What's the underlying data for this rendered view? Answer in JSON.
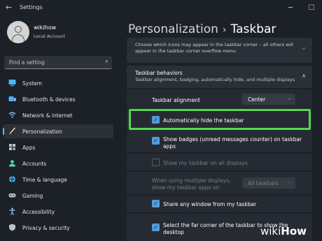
{
  "window": {
    "title": "Settings",
    "back_glyph": "←",
    "minimize_glyph": "─",
    "maximize_glyph": "☐"
  },
  "user": {
    "name": "wikihow",
    "account_type": "Local Account"
  },
  "search": {
    "placeholder": "Find a setting"
  },
  "sidebar": {
    "items": [
      {
        "label": "System",
        "icon": "monitor-icon",
        "color": "#4cb4ff"
      },
      {
        "label": "Bluetooth & devices",
        "icon": "bluetooth-icon",
        "color": "#4cb4ff"
      },
      {
        "label": "Network & internet",
        "icon": "wifi-icon",
        "color": "#8fc9ff"
      },
      {
        "label": "Personalization",
        "icon": "brush-icon",
        "color": "#f0a070",
        "active": true
      },
      {
        "label": "Apps",
        "icon": "apps-icon",
        "color": "#b8c4d4"
      },
      {
        "label": "Accounts",
        "icon": "accounts-icon",
        "color": "#5cd0a0"
      },
      {
        "label": "Time & language",
        "icon": "globe-icon",
        "color": "#4cb4ff"
      },
      {
        "label": "Gaming",
        "icon": "gamepad-icon",
        "color": "#b8c4d4"
      },
      {
        "label": "Accessibility",
        "icon": "accessibility-icon",
        "color": "#8fc9ff"
      },
      {
        "label": "Privacy & security",
        "icon": "shield-icon",
        "color": "#b8c4d4"
      }
    ]
  },
  "header": {
    "breadcrumb_parent": "Personalization",
    "breadcrumb_separator": "›",
    "page_title": "Taskbar"
  },
  "corner_overflow": {
    "description": "Choose which icons may appear in the taskbar corner – all others will appear in the taskbar corner overflow menu"
  },
  "behaviors": {
    "title": "Taskbar behaviors",
    "subtitle": "Taskbar alignment, badging, automatically hide, and multiple displays",
    "alignment_label": "Taskbar alignment",
    "alignment_value": "Center",
    "auto_hide_label": "Automatically hide the taskbar",
    "auto_hide_checked": true,
    "badges_label": "Show badges (unread messages counter) on taskbar apps",
    "badges_checked": true,
    "all_displays_label": "Show my taskbar on all displays",
    "all_displays_checked": false,
    "multi_display_label": "When using multiple displays, show my taskbar apps on",
    "multi_display_value": "All taskbars",
    "share_window_label": "Share any window from my taskbar",
    "share_window_checked": true,
    "far_corner_label": "Select the far corner of the taskbar to show the desktop",
    "far_corner_checked": true
  },
  "watermark": {
    "part1": "wiki",
    "part2": "How"
  },
  "colors": {
    "accent": "#4f9ddd",
    "highlight": "#52d94a",
    "background": "#1c2128",
    "card": "#2a3038"
  }
}
